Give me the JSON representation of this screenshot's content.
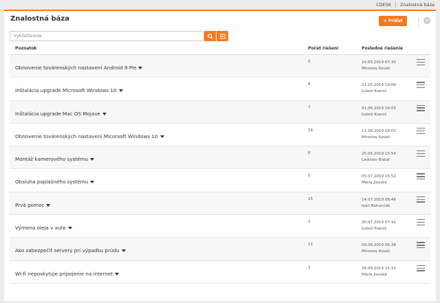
{
  "breadcrumb": {
    "root": "CDESK",
    "current": "Znalostná báza"
  },
  "page": {
    "title": "Znalostná báza",
    "add_label": "+ Pridať"
  },
  "search": {
    "placeholder": "Vyhľadávanie"
  },
  "icons": {
    "search_button": "search-icon",
    "filter_button": "plus-square-icon",
    "settings": "gear-icon",
    "row_menu": "hamburger-icon",
    "row_toggle": "caret-down-icon"
  },
  "colors": {
    "accent": "#f47a20"
  },
  "table": {
    "columns": {
      "name": "Poznatok",
      "count": "Počet riešení",
      "last": "Posledné riešenie"
    },
    "rows": [
      {
        "name": "Obnovenie továrenských nastavení Android 9 Pie",
        "count": "5",
        "date": "10.05.2019 07:30",
        "user": "Miroslav Kováč"
      },
      {
        "name": "Inštalácia upgrade Microsoft Windows 10",
        "count": "8",
        "date": "21.05.2019 19:06",
        "user": "Ľuboš Ksenič"
      },
      {
        "name": "Inštalácia upgrade Mac OS Mojave",
        "count": "7",
        "date": "01.06.2019 16:05",
        "user": "Ľuboš Ksenič"
      },
      {
        "name": "Obnovenie továrenských nastavení Micorsoft Windows 10",
        "count": "14",
        "date": "11.06.2019 18:01",
        "user": "Miroslav Kováč"
      },
      {
        "name": "Montáž kamerového systému",
        "count": "8",
        "date": "25.06.2019 15:54",
        "user": "Ladislav Bobaľ"
      },
      {
        "name": "Obsluha poplašného systému",
        "count": "5",
        "date": "05.07.2019 15:52",
        "user": "Mária Jlavská"
      },
      {
        "name": "Prvá pomoc",
        "count": "15",
        "date": "14.07.2019 08:46",
        "user": "Ivan Bohunčák"
      },
      {
        "name": "Výmena oleja v aute",
        "count": "1",
        "date": "30.07.2019 07:42",
        "user": "Ľuboš Ksenič"
      },
      {
        "name": "Ako zabezpečiť servery pri výpadku prúdu",
        "count": "11",
        "date": "09.08.2019 06:38",
        "user": "Miroslav Kováč"
      },
      {
        "name": "Wi-fi neposkytuje pripojenie na internet",
        "count": "3",
        "date": "28.08.2019 15:31",
        "user": "Mária Jlavská"
      }
    ]
  }
}
